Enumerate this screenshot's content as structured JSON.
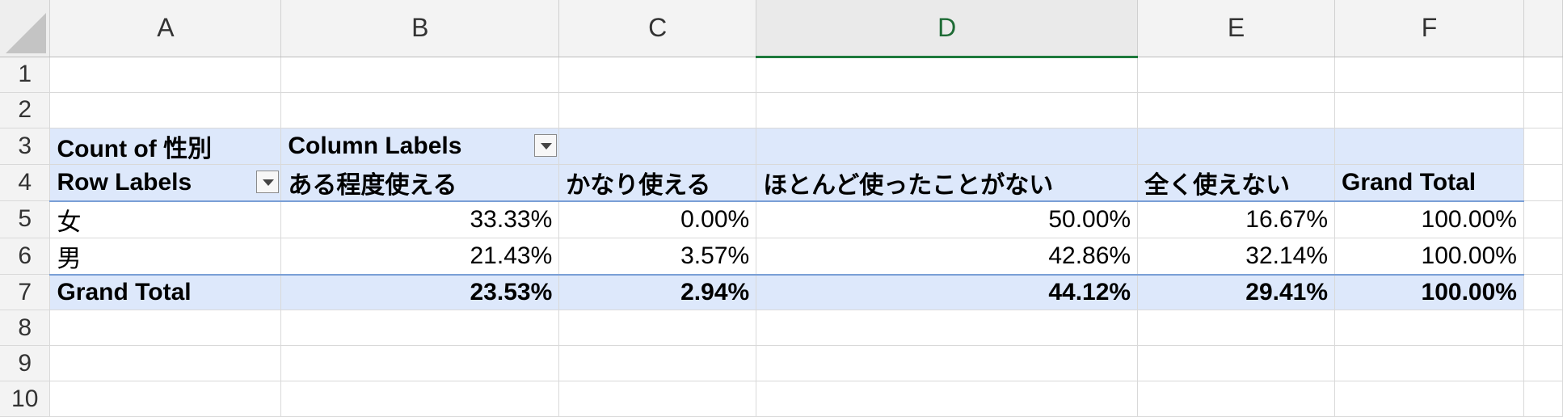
{
  "columns": [
    "A",
    "B",
    "C",
    "D",
    "E",
    "F"
  ],
  "selected_column": "D",
  "row_numbers": [
    "1",
    "2",
    "3",
    "4",
    "5",
    "6",
    "7",
    "8",
    "9",
    "10"
  ],
  "pivot": {
    "value_field": "Count of 性別",
    "column_labels": "Column Labels",
    "row_labels": "Row Labels",
    "headers": [
      "ある程度使える",
      "かなり使える",
      "ほとんど使ったことがない",
      "全く使えない",
      "Grand Total"
    ],
    "rows": [
      {
        "label": "女",
        "values": [
          "33.33%",
          "0.00%",
          "50.00%",
          "16.67%",
          "100.00%"
        ]
      },
      {
        "label": "男",
        "values": [
          "21.43%",
          "3.57%",
          "42.86%",
          "32.14%",
          "100.00%"
        ]
      }
    ],
    "grand_total": {
      "label": "Grand Total",
      "values": [
        "23.53%",
        "2.94%",
        "44.12%",
        "29.41%",
        "100.00%"
      ]
    }
  },
  "colors": {
    "pivot_fill": "#dde8fb",
    "selected_header": "#1e7a3c"
  },
  "icons": {
    "filter_dropdown": "chevron-down-icon"
  }
}
